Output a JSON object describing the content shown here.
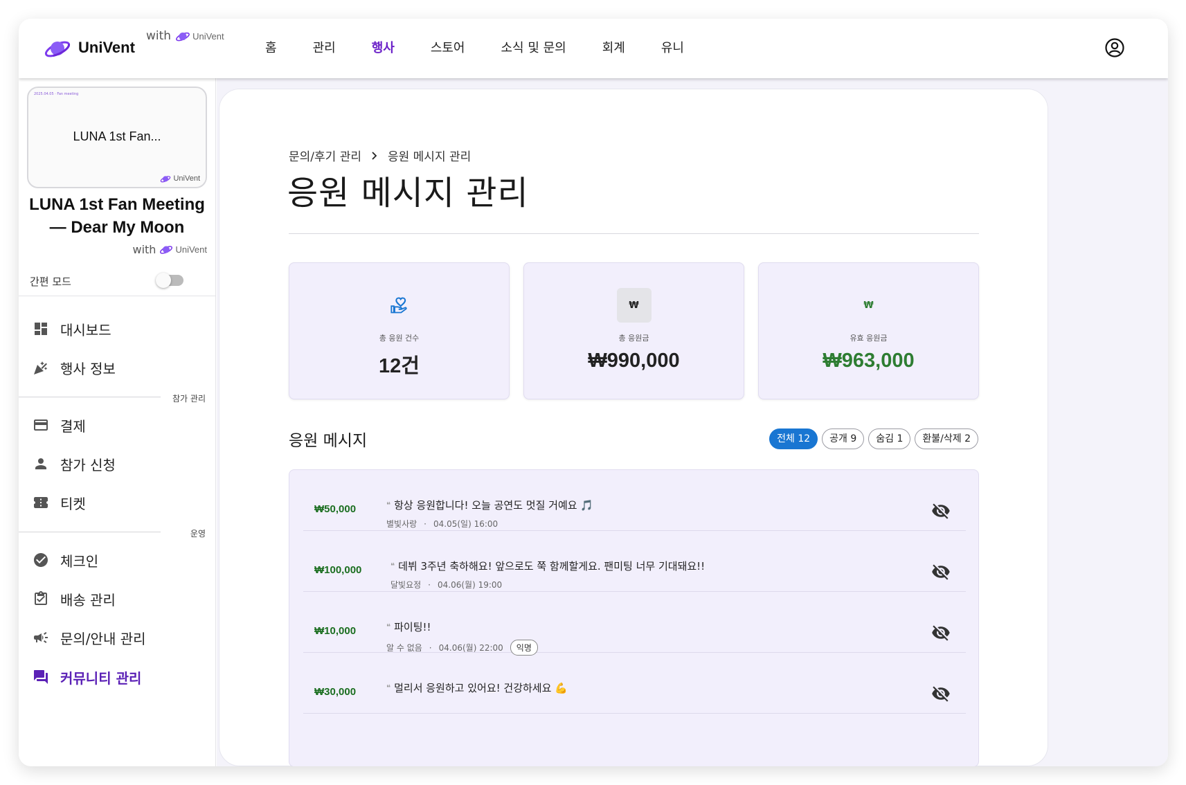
{
  "brand": {
    "name": "UniVent",
    "with": "with",
    "mini_name": "UniVent"
  },
  "nav": [
    {
      "label": "홈"
    },
    {
      "label": "관리"
    },
    {
      "label": "행사",
      "active": true
    },
    {
      "label": "스토어"
    },
    {
      "label": "소식 및 문의"
    },
    {
      "label": "회계"
    },
    {
      "label": "유니"
    }
  ],
  "sidebar": {
    "thumb_title": "LUNA 1st Fan...",
    "thumb_tiny": "2025.04.05 · Fan meeting",
    "thumb_brand": "UniVent",
    "event_title": "LUNA 1st Fan Meeting — Dear My Moon",
    "with": "with",
    "brand": "UniVent",
    "easy_mode": "간편 모드",
    "items": [
      {
        "label": "대시보드",
        "icon": "dashboard-icon"
      },
      {
        "label": "행사 정보",
        "icon": "celebration-icon"
      },
      {
        "label": "결제",
        "icon": "credit-card-icon"
      },
      {
        "label": "참가 신청",
        "icon": "person-icon"
      },
      {
        "label": "티켓",
        "icon": "ticket-icon"
      },
      {
        "label": "체크인",
        "icon": "check-circle-icon"
      },
      {
        "label": "배송 관리",
        "icon": "clipboard-check-icon"
      },
      {
        "label": "문의/안내 관리",
        "icon": "campaign-icon"
      },
      {
        "label": "커뮤니티 관리",
        "icon": "forum-icon",
        "active": true
      }
    ],
    "sections": {
      "participation": "참가 관리",
      "operation": "운영"
    }
  },
  "main": {
    "breadcrumb": {
      "parent": "문의/후기 관리",
      "current": "응원 메시지 관리"
    },
    "title": "응원 메시지 관리",
    "stats": [
      {
        "label": "총 응원 건수",
        "value": "12건",
        "icon": "volunteer-heart-icon"
      },
      {
        "label": "총 응원금",
        "value": "₩990,000",
        "icon": "won-icon",
        "icon_text": "₩"
      },
      {
        "label": "유효 응원금",
        "value": "₩963,000",
        "icon": "won-icon",
        "icon_text": "₩"
      }
    ],
    "section_title": "응원 메시지",
    "filters": [
      {
        "label": "전체 12",
        "active": true
      },
      {
        "label": "공개 9"
      },
      {
        "label": "숨김 1"
      },
      {
        "label": "환불/삭제 2"
      }
    ],
    "messages": [
      {
        "amount": "₩50,000",
        "quote": "❛❛",
        "text": "항상 응원합니다! 오늘 공연도 멋질 거예요 🎵",
        "author": "별빛사랑",
        "date": "04.05(일) 16:00"
      },
      {
        "amount": "₩100,000",
        "quote": "❛❛",
        "text": "데뷔 3주년 축하해요! 앞으로도 쭉 함께할게요. 팬미팅 너무 기대돼요!!",
        "author": "달빛요정",
        "date": "04.06(월) 19:00"
      },
      {
        "amount": "₩10,000",
        "quote": "❛❛",
        "text": "파이팅!!",
        "author": "알 수 없음",
        "date": "04.06(월) 22:00",
        "badge": "익명"
      },
      {
        "amount": "₩30,000",
        "quote": "❛❛",
        "text": "멀리서 응원하고 있어요! 건강하세요 💪",
        "author": "",
        "date": ""
      }
    ]
  },
  "colors": {
    "accent": "#6b21c8",
    "sidebar_active": "#5b21b6",
    "chip_active": "#1976d2",
    "money_green": "#2e7d32",
    "panel": "#f2effc"
  }
}
